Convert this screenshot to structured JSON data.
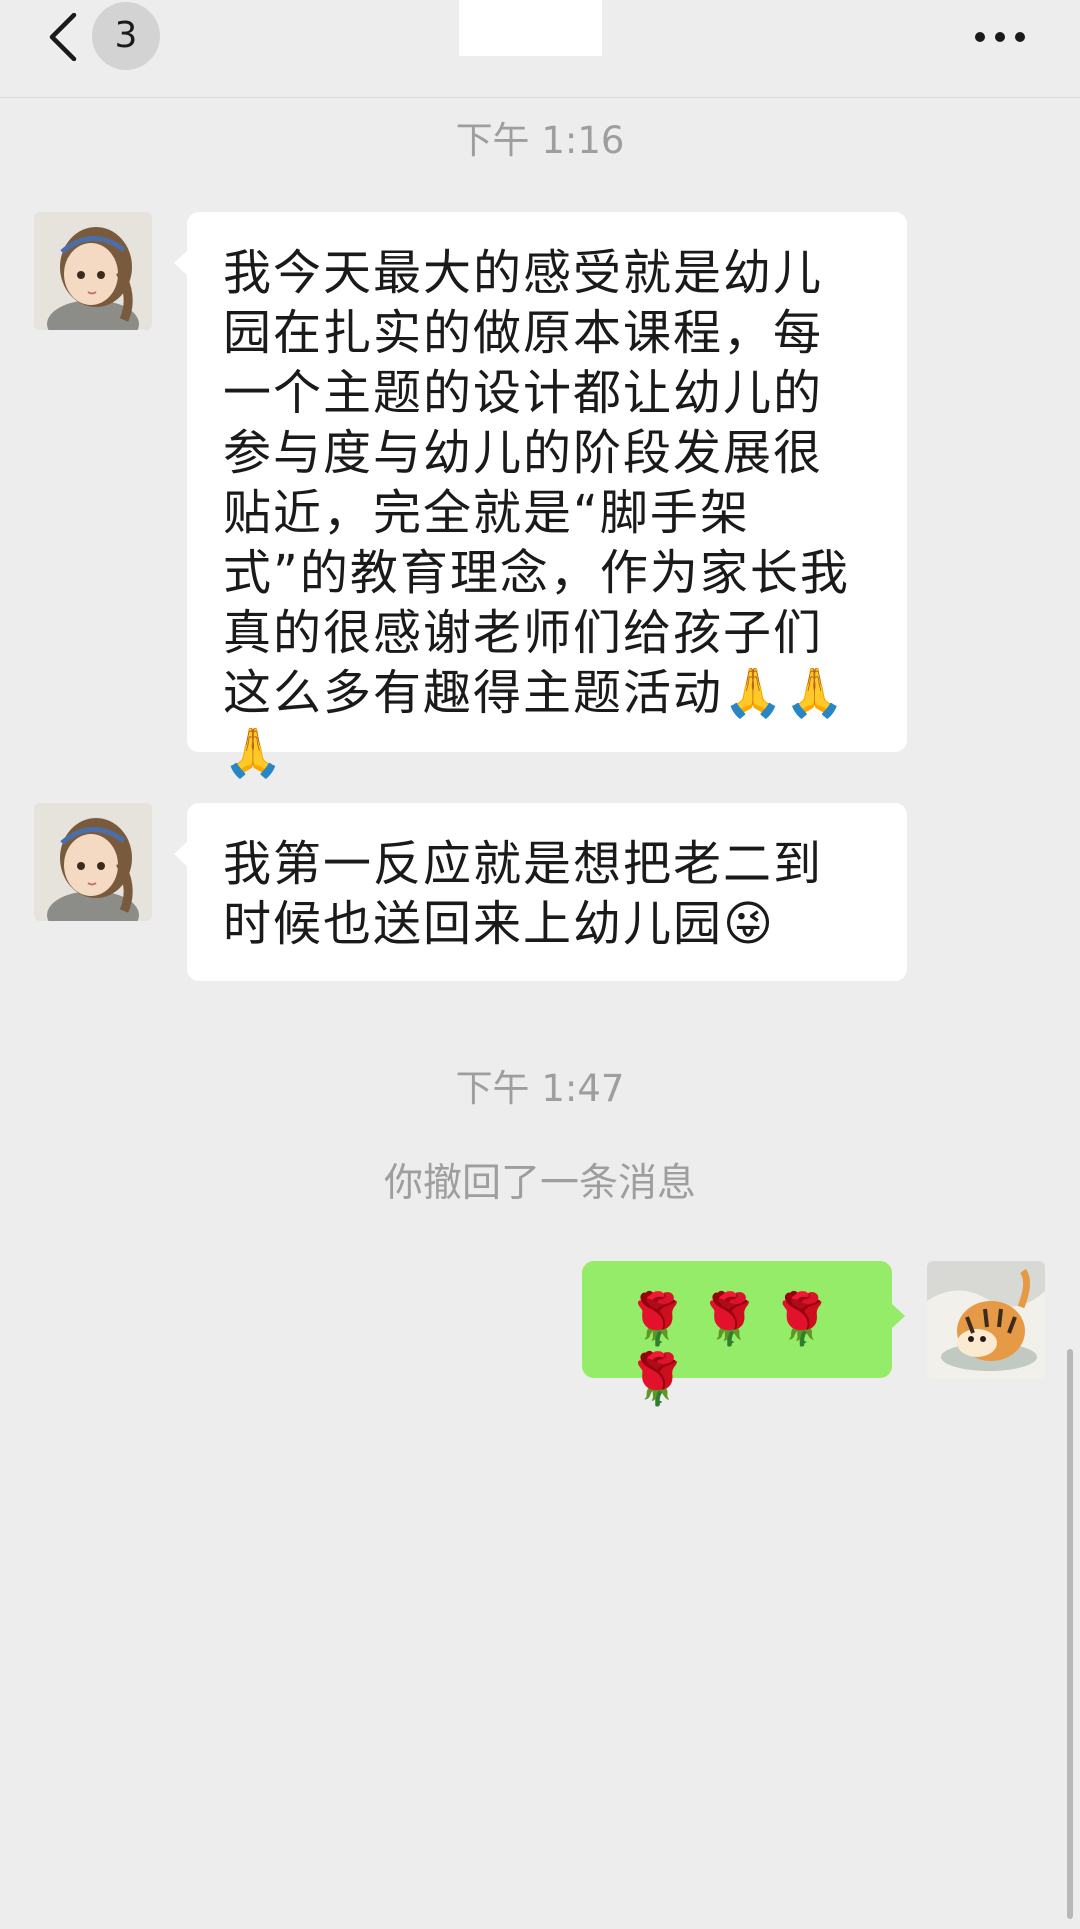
{
  "header": {
    "back_icon": "chevron-left-icon",
    "unread_count": "3",
    "more_icon": "more-dots-icon"
  },
  "messages": {
    "time_1": "下午 1:16",
    "msg_1": "我今天最大的感受就是幼儿园在扎实的做原本课程，每一个主题的设计都让幼儿的参与度与幼儿的阶段发展很贴近，完全就是“脚手架式”的教育理念，作为家长我真的很感谢老师们给孩子们这么多有趣得主题活动🙏🙏🙏",
    "msg_2": "我第一反应就是想把老二到时候也送回来上幼儿园😜",
    "time_2": "下午 1:47",
    "recall_notice": "你撤回了一条消息",
    "msg_3": "🌹🌹🌹🌹"
  },
  "colors": {
    "background": "#ededed",
    "incoming_bubble": "#ffffff",
    "outgoing_bubble": "#95ec69",
    "timestamp": "#9e9e9e"
  }
}
